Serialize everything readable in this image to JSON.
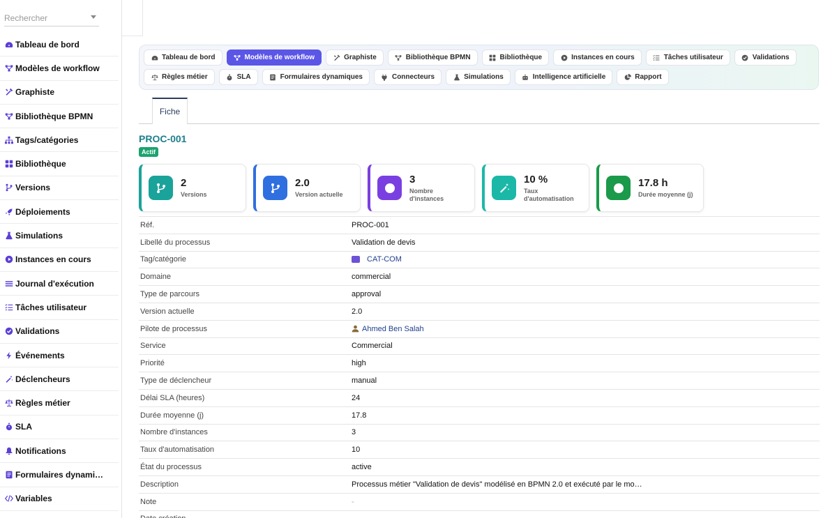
{
  "search": {
    "placeholder": "Rechercher"
  },
  "sidebar": {
    "items": [
      {
        "label": "Tableau de bord",
        "icon": "gauge-icon"
      },
      {
        "label": "Modèles de workflow",
        "icon": "workflow-icon"
      },
      {
        "label": "Graphiste",
        "icon": "tools-icon"
      },
      {
        "label": "Bibliothèque BPMN",
        "icon": "workflow-icon"
      },
      {
        "label": "Tags/catégories",
        "icon": "sitemap-icon"
      },
      {
        "label": "Bibliothèque",
        "icon": "grid-icon"
      },
      {
        "label": "Versions",
        "icon": "branch-icon"
      },
      {
        "label": "Déploiements",
        "icon": "rocket-icon"
      },
      {
        "label": "Simulations",
        "icon": "flask-icon"
      },
      {
        "label": "Instances en cours",
        "icon": "play-circle-icon"
      },
      {
        "label": "Journal d'exécution",
        "icon": "list-icon"
      },
      {
        "label": "Tâches utilisateur",
        "icon": "tasks-icon"
      },
      {
        "label": "Validations",
        "icon": "check-circle-icon"
      },
      {
        "label": "Événements",
        "icon": "bolt-icon"
      },
      {
        "label": "Déclencheurs",
        "icon": "wand-icon"
      },
      {
        "label": "Règles métier",
        "icon": "scale-icon"
      },
      {
        "label": "SLA",
        "icon": "stopwatch-icon"
      },
      {
        "label": "Notifications",
        "icon": "bell-icon"
      },
      {
        "label": "Formulaires dynami…",
        "icon": "form-icon"
      },
      {
        "label": "Variables",
        "icon": "code-icon"
      }
    ]
  },
  "tabs": {
    "row1": [
      {
        "label": "Tableau de bord",
        "icon": "gauge-icon",
        "active": false
      },
      {
        "label": "Modèles de workflow",
        "icon": "workflow-icon",
        "active": true
      },
      {
        "label": "Graphiste",
        "icon": "tools-icon",
        "active": false
      },
      {
        "label": "Bibliothèque BPMN",
        "icon": "workflow-icon",
        "active": false
      },
      {
        "label": "Bibliothèque",
        "icon": "grid-icon",
        "active": false
      },
      {
        "label": "Instances en cours",
        "icon": "play-circle-icon",
        "active": false
      },
      {
        "label": "Tâches utilisateur",
        "icon": "tasks-icon",
        "active": false
      },
      {
        "label": "Validations",
        "icon": "check-circle-icon",
        "active": false
      }
    ],
    "row2": [
      {
        "label": "Règles métier",
        "icon": "scale-icon",
        "active": false
      },
      {
        "label": "SLA",
        "icon": "stopwatch-icon",
        "active": false
      },
      {
        "label": "Formulaires dynamiques",
        "icon": "form-icon",
        "active": false
      },
      {
        "label": "Connecteurs",
        "icon": "plug-icon",
        "active": false
      },
      {
        "label": "Simulations",
        "icon": "flask-icon",
        "active": false
      },
      {
        "label": "Intelligence artificielle",
        "icon": "robot-icon",
        "active": false
      },
      {
        "label": "Rapport",
        "icon": "pie-chart-icon",
        "active": false
      }
    ]
  },
  "subtab": {
    "label": "Fiche"
  },
  "record": {
    "ref": "PROC-001",
    "status": "Actif"
  },
  "kpis": [
    {
      "value": "2",
      "label": "Versions",
      "color": "#1aa39a",
      "icon": "branch-icon"
    },
    {
      "value": "2.0",
      "label": "Version actuelle",
      "color": "#2f6fe0",
      "icon": "branch-icon"
    },
    {
      "value": "3",
      "label": "Nombre d'instances",
      "color": "#7a3fe0",
      "icon": "play-circle-icon"
    },
    {
      "value": "10 %",
      "label": "Taux d'automatisation",
      "color": "#1bb8a8",
      "icon": "wand-icon"
    },
    {
      "value": "17.8 h",
      "label": "Durée moyenne (j)",
      "color": "#1a9a4a",
      "icon": "clock-icon"
    }
  ],
  "details": [
    {
      "key": "Réf.",
      "value": "PROC-001"
    },
    {
      "key": "Libellé du processus",
      "value": "Validation de devis"
    },
    {
      "key": "Tag/catégorie",
      "value": "CAT-COM",
      "type": "tag"
    },
    {
      "key": "Domaine",
      "value": "commercial"
    },
    {
      "key": "Type de parcours",
      "value": "approval"
    },
    {
      "key": "Version actuelle",
      "value": "2.0"
    },
    {
      "key": "Pilote de processus",
      "value": "Ahmed Ben Salah",
      "type": "user"
    },
    {
      "key": "Service",
      "value": "Commercial"
    },
    {
      "key": "Priorité",
      "value": "high"
    },
    {
      "key": "Type de déclencheur",
      "value": "manual"
    },
    {
      "key": "Délai SLA (heures)",
      "value": "24"
    },
    {
      "key": "Durée moyenne (j)",
      "value": "17.8"
    },
    {
      "key": "Nombre d'instances",
      "value": "3"
    },
    {
      "key": "Taux d'automatisation",
      "value": "10"
    },
    {
      "key": "État du processus",
      "value": "active"
    },
    {
      "key": "Description",
      "value": "Processus métier \"Validation de devis\" modélisé en BPMN 2.0 et exécuté par le mo…"
    },
    {
      "key": "Note",
      "value": "-",
      "type": "muted"
    },
    {
      "key": "Date création",
      "value": ""
    }
  ]
}
